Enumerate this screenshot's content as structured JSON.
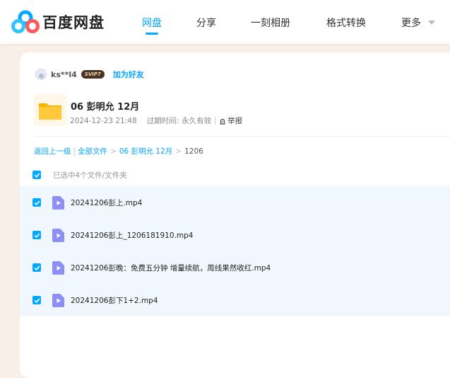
{
  "brand": {
    "name": "百度网盘"
  },
  "nav": {
    "items": [
      {
        "label": "网盘",
        "active": true
      },
      {
        "label": "分享",
        "active": false
      },
      {
        "label": "一刻相册",
        "active": false
      },
      {
        "label": "格式转换",
        "active": false
      },
      {
        "label": "更多",
        "active": false
      }
    ],
    "accent_color": "#06a7ff"
  },
  "sharer": {
    "name": "ks**l4",
    "badge": "SVIP7",
    "add_friend_label": "加为好友"
  },
  "share": {
    "title": "06 彭明允 12月",
    "date": "2024-12-23 21:48",
    "expiry_label": "过期时间:",
    "expiry_value": "永久有效",
    "report_label": "举报"
  },
  "breadcrumb": {
    "back_label": "返回上一级",
    "all_files_label": "全部文件",
    "folder_label": "06 彭明允 12月",
    "current_label": "1206"
  },
  "selection": {
    "summary": "已选中4个文件/文件夹"
  },
  "files": [
    {
      "name": "20241206彭上.mp4",
      "checked": true,
      "icon": "video-file-icon"
    },
    {
      "name": "20241206彭上_1206181910.mp4",
      "checked": true,
      "icon": "video-file-icon"
    },
    {
      "name": "20241206彭晚：免费五分钟 增量续航，周线果然收红.mp4",
      "checked": true,
      "icon": "video-file-icon"
    },
    {
      "name": "20241206彭下1+2.mp4",
      "checked": true,
      "icon": "video-file-icon"
    }
  ]
}
